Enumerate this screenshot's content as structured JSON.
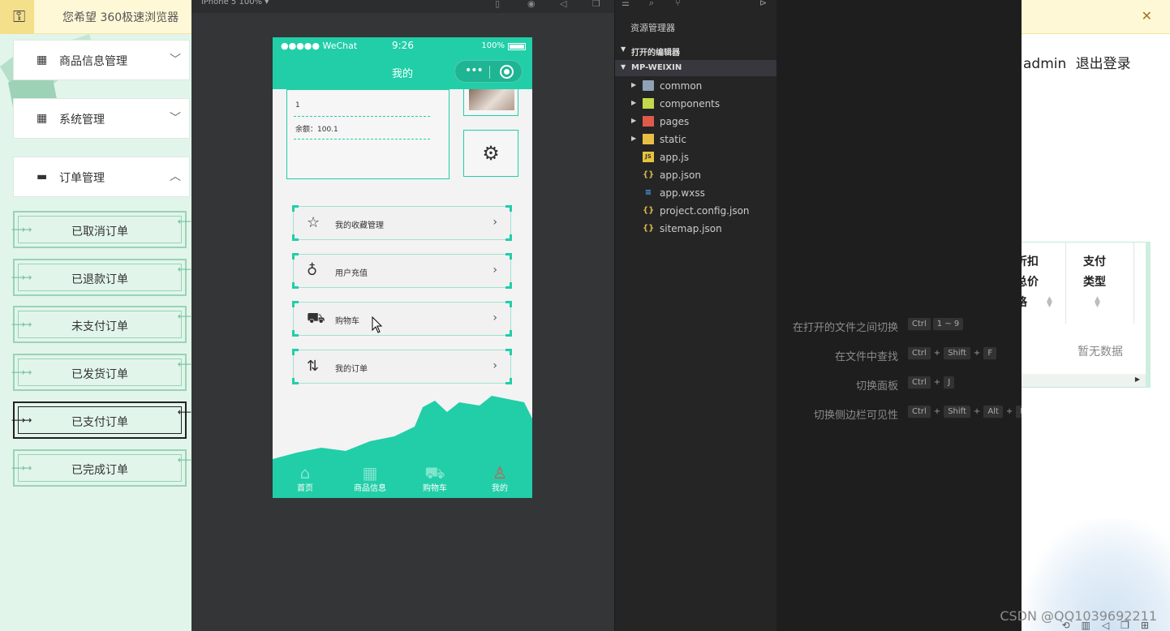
{
  "left_panel": {
    "notice_text": "您希望 360极速浏览器",
    "menus": [
      {
        "icon": "grid-icon",
        "label": "商品信息管理",
        "expanded": false
      },
      {
        "icon": "grid-icon",
        "label": "系统管理",
        "expanded": false
      },
      {
        "icon": "briefcase-icon",
        "label": "订单管理",
        "expanded": true
      }
    ],
    "submenu": [
      "已取消订单",
      "已退款订单",
      "未支付订单",
      "已发货订单",
      "已支付订单",
      "已完成订单"
    ],
    "active_submenu": "已支付订单"
  },
  "simulator": {
    "device_label": "iPhone 5 100% ▾",
    "status": {
      "carrier": "●●●●● WeChat",
      "time": "9:26",
      "battery": "100%"
    },
    "nav_title": "我的",
    "info_lines": [
      "1",
      "余额：100.1"
    ],
    "menu_items": [
      {
        "icon": "star-icon",
        "label": "我的收藏管理"
      },
      {
        "icon": "money-bag-icon",
        "label": "用户充值"
      },
      {
        "icon": "cart-icon",
        "label": "购物车"
      },
      {
        "icon": "sort-icon",
        "label": "我的订单"
      }
    ],
    "tabs": [
      {
        "icon": "home-icon",
        "label": "首页"
      },
      {
        "icon": "category-icon",
        "label": "商品信息"
      },
      {
        "icon": "cart-icon",
        "label": "购物车"
      },
      {
        "icon": "user-icon",
        "label": "我的"
      }
    ],
    "active_tab": "我的",
    "colors": {
      "accent": "#21cea8"
    }
  },
  "explorer": {
    "title": "资源管理器",
    "open_editors": "打开的编辑器",
    "project": "MP-WEIXIN",
    "files": [
      {
        "name": "common",
        "type": "folder"
      },
      {
        "name": "components",
        "type": "folder"
      },
      {
        "name": "pages",
        "type": "folder"
      },
      {
        "name": "static",
        "type": "folder"
      },
      {
        "name": "app.js",
        "type": "js"
      },
      {
        "name": "app.json",
        "type": "json"
      },
      {
        "name": "app.wxss",
        "type": "css"
      },
      {
        "name": "project.config.json",
        "type": "json"
      },
      {
        "name": "sitemap.json",
        "type": "json"
      }
    ]
  },
  "editor": {
    "shortcuts": [
      {
        "label": "在打开的文件之间切换",
        "keys": [
          "Ctrl",
          "1 ~ 9"
        ]
      },
      {
        "label": "在文件中查找",
        "keys": [
          "Ctrl",
          "Shift",
          "F"
        ]
      },
      {
        "label": "切换面板",
        "keys": [
          "Ctrl",
          "J"
        ]
      },
      {
        "label": "切换侧边栏可见性",
        "keys": [
          "Ctrl",
          "Shift",
          "Alt",
          "B"
        ]
      }
    ]
  },
  "right_page": {
    "user": "admin",
    "logout": "退出登录",
    "col1": [
      "折扣",
      "总价",
      "格"
    ],
    "col2": [
      "支付",
      "类型"
    ],
    "no_data": "暂无数据",
    "watermark": "CSDN @QQ1039692211"
  }
}
